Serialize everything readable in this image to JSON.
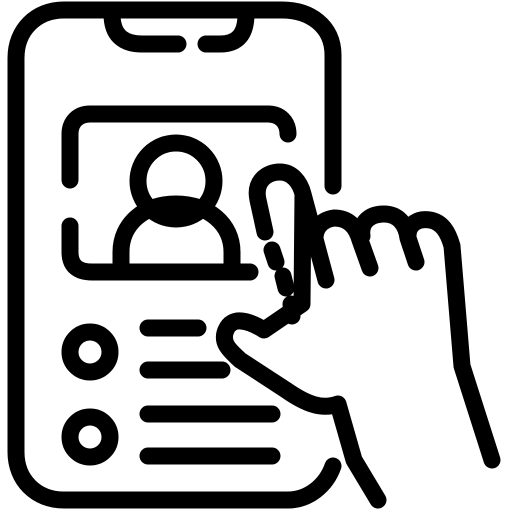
{
  "icon": {
    "semantic": "phone-profile-touch-icon",
    "stroke_color": "#000000",
    "background_color": "#ffffff",
    "parts": [
      "smartphone-frame",
      "profile-card",
      "user-avatar",
      "option-list",
      "pointing-hand"
    ]
  }
}
